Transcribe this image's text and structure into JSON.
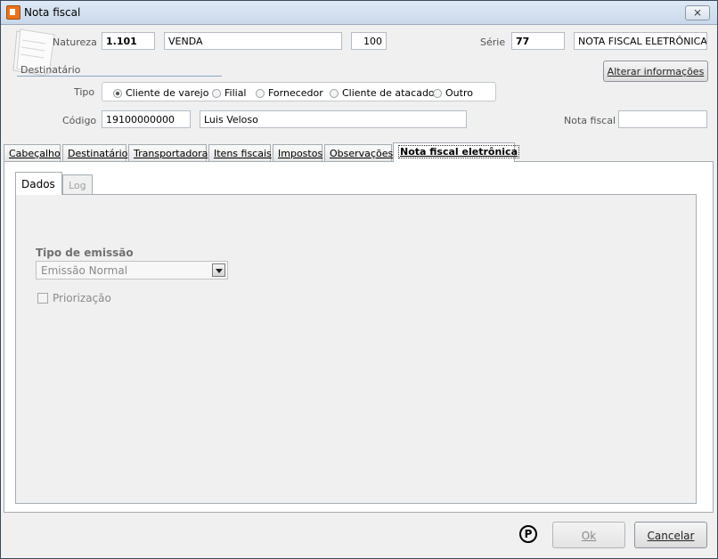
{
  "window": {
    "title": "Nota fiscal",
    "close_glyph": "⨯"
  },
  "header": {
    "natureza_label": "Natureza",
    "natureza_code": "1.101",
    "natureza_desc": "VENDA",
    "natureza_num": "100",
    "serie_label": "Série",
    "serie_value": "77",
    "serie_desc": "NOTA FISCAL ELETRÔNICA",
    "destinatario_label": "Destinatário",
    "alterar_label": "Alterar informações",
    "tipo_label": "Tipo",
    "tipo_options": [
      "Cliente de varejo",
      "Filial",
      "Fornecedor",
      "Cliente de atacado",
      "Outro"
    ],
    "tipo_selected": "Cliente de varejo",
    "codigo_label": "Código",
    "codigo_value": "19100000000",
    "cliente_nome": "Luis Veloso",
    "nota_fiscal_label": "Nota fiscal",
    "nota_fiscal_value": ""
  },
  "tabs": [
    {
      "label": "Cabeçalho"
    },
    {
      "label": "Destinatário"
    },
    {
      "label": "Transportadora"
    },
    {
      "label": "Itens fiscais"
    },
    {
      "label": "Impostos"
    },
    {
      "label": "Observações"
    },
    {
      "label": "Nota fiscal eletrônica"
    }
  ],
  "active_tab": "Nota fiscal eletrônica",
  "subtabs": [
    {
      "label": "Dados"
    },
    {
      "label": "Log"
    }
  ],
  "content": {
    "tipo_emissao_label": "Tipo de emissão",
    "tipo_emissao_value": "Emissão Normal",
    "priorizacao_label": "Priorização",
    "priorizacao_checked": false
  },
  "footer": {
    "p_icon": "P",
    "ok_label": "Ok",
    "cancelar_label": "Cancelar"
  },
  "colors": {
    "titlebar": "#c9d8ea",
    "accent": "#e8741f"
  }
}
